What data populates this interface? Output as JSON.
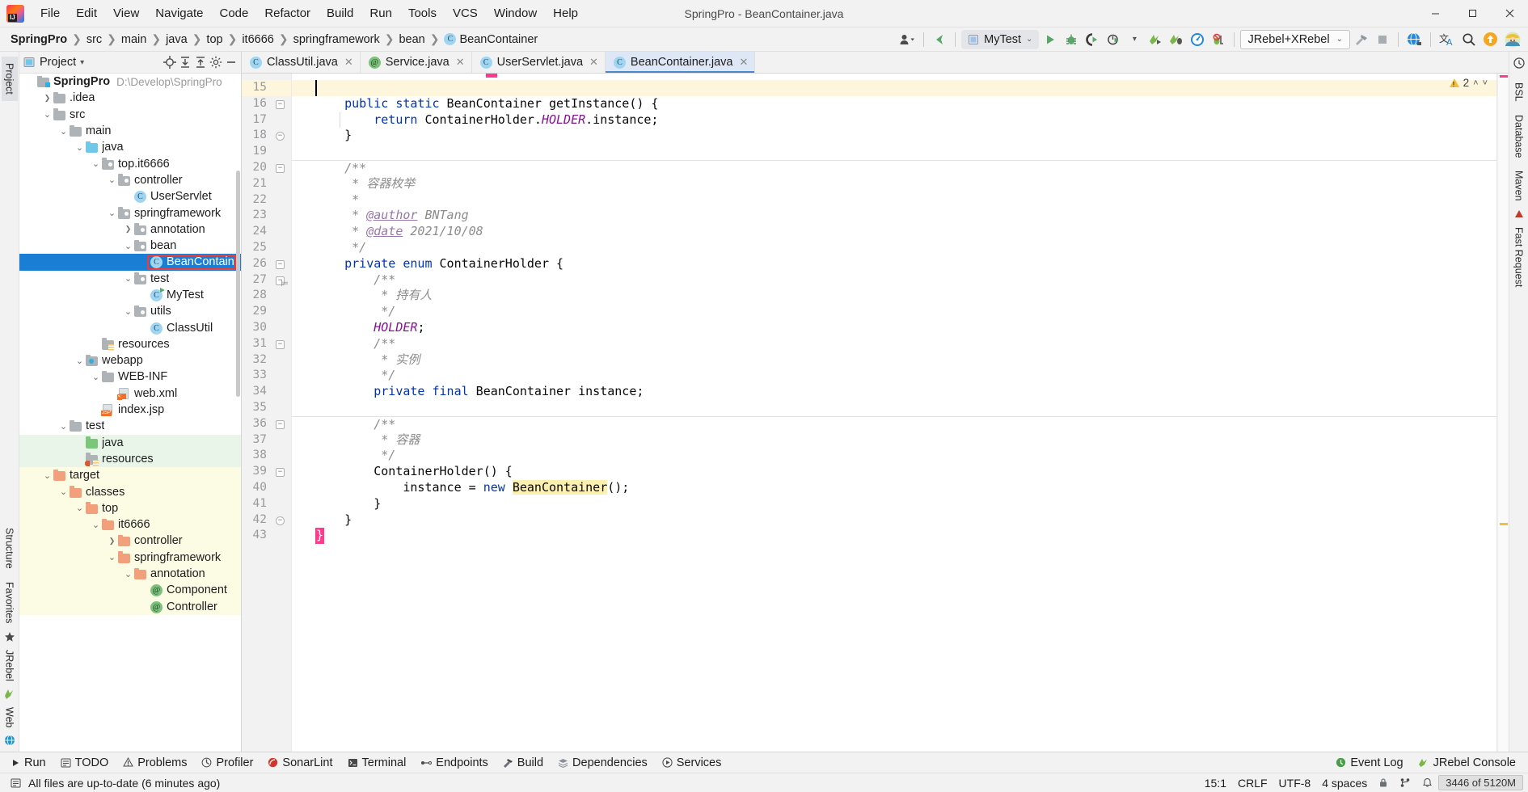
{
  "window": {
    "title": "SpringPro - BeanContainer.java",
    "controls": {
      "minimize": "—",
      "maximize": "▢",
      "close": "✕"
    }
  },
  "menu": [
    {
      "label": "File"
    },
    {
      "label": "Edit"
    },
    {
      "label": "View"
    },
    {
      "label": "Navigate"
    },
    {
      "label": "Code"
    },
    {
      "label": "Refactor"
    },
    {
      "label": "Build"
    },
    {
      "label": "Run"
    },
    {
      "label": "Tools"
    },
    {
      "label": "VCS"
    },
    {
      "label": "Window"
    },
    {
      "label": "Help"
    }
  ],
  "breadcrumbs": [
    {
      "label": "SpringPro",
      "bold": true
    },
    {
      "label": "src"
    },
    {
      "label": "main"
    },
    {
      "label": "java"
    },
    {
      "label": "top"
    },
    {
      "label": "it6666"
    },
    {
      "label": "springframework"
    },
    {
      "label": "bean"
    },
    {
      "label": "BeanContainer",
      "icon": "class-icon"
    }
  ],
  "toolbar": {
    "run_config": "MyTest",
    "jrebel_config": "JRebel+XRebel",
    "icons": [
      "user-settings-icon",
      "back-arrow-icon",
      "run-icon",
      "debug-icon",
      "run-coverage-icon",
      "profile-icon",
      "jrebel-run-icon",
      "jrebel-debug-icon",
      "xrebel-icon",
      "stop-debug-icon",
      "hammer-icon",
      "stop-icon",
      "jrebel-globe-icon",
      "translate-icon",
      "search-everywhere-icon",
      "update-icon",
      "avatar-icon"
    ]
  },
  "left_rail": {
    "top": [
      "Project"
    ],
    "middle": [
      "Structure",
      "Favorites"
    ],
    "bottom": [
      "JRebel",
      "Web"
    ]
  },
  "right_rail": {
    "items": [
      "BSL",
      "Database",
      "Maven",
      "Fast Request"
    ]
  },
  "project_panel": {
    "title": "Project",
    "actions": [
      "locate-icon",
      "expand-all-icon",
      "collapse-all-icon",
      "gear-icon",
      "hide-icon"
    ],
    "tree": [
      {
        "depth": 0,
        "label": "SpringPro",
        "path": "D:\\Develop\\SpringPro",
        "icon": "module-folder",
        "arrow": "",
        "bold": true
      },
      {
        "depth": 1,
        "label": ".idea",
        "icon": "folder-gray",
        "arrow": "right"
      },
      {
        "depth": 1,
        "label": "src",
        "icon": "folder-gray",
        "arrow": "down"
      },
      {
        "depth": 2,
        "label": "main",
        "icon": "folder-gray",
        "arrow": "down"
      },
      {
        "depth": 3,
        "label": "java",
        "icon": "folder-blue",
        "arrow": "down"
      },
      {
        "depth": 4,
        "label": "top.it6666",
        "icon": "package",
        "arrow": "down"
      },
      {
        "depth": 5,
        "label": "controller",
        "icon": "package",
        "arrow": "down"
      },
      {
        "depth": 6,
        "label": "UserServlet",
        "icon": "class"
      },
      {
        "depth": 5,
        "label": "springframework",
        "icon": "package",
        "arrow": "down"
      },
      {
        "depth": 6,
        "label": "annotation",
        "icon": "package",
        "arrow": "right"
      },
      {
        "depth": 6,
        "label": "bean",
        "icon": "package",
        "arrow": "down"
      },
      {
        "depth": 7,
        "label": "BeanContainer",
        "icon": "class",
        "selected": true,
        "outlined": true
      },
      {
        "depth": 6,
        "label": "test",
        "icon": "package",
        "arrow": "down"
      },
      {
        "depth": 7,
        "label": "MyTest",
        "icon": "class-runnable"
      },
      {
        "depth": 6,
        "label": "utils",
        "icon": "package",
        "arrow": "down"
      },
      {
        "depth": 7,
        "label": "ClassUtil",
        "icon": "class"
      },
      {
        "depth": 4,
        "label": "resources",
        "icon": "resource-folder"
      },
      {
        "depth": 3,
        "label": "webapp",
        "icon": "webapp-folder",
        "arrow": "down"
      },
      {
        "depth": 4,
        "label": "WEB-INF",
        "icon": "folder-gray",
        "arrow": "down"
      },
      {
        "depth": 5,
        "label": "web.xml",
        "icon": "xml-file"
      },
      {
        "depth": 4,
        "label": "index.jsp",
        "icon": "jsp-file"
      },
      {
        "depth": 2,
        "label": "test",
        "icon": "folder-gray",
        "arrow": "down"
      },
      {
        "depth": 3,
        "label": "java",
        "icon": "folder-green",
        "arrow": "",
        "bg": "green"
      },
      {
        "depth": 3,
        "label": "resources",
        "icon": "test-resource-folder",
        "bg": "green"
      },
      {
        "depth": 1,
        "label": "target",
        "icon": "folder-orange",
        "arrow": "down",
        "bg": "yellow"
      },
      {
        "depth": 2,
        "label": "classes",
        "icon": "folder-orange",
        "arrow": "down",
        "bg": "yellow"
      },
      {
        "depth": 3,
        "label": "top",
        "icon": "folder-orange",
        "arrow": "down",
        "bg": "yellow"
      },
      {
        "depth": 4,
        "label": "it6666",
        "icon": "folder-orange",
        "arrow": "down",
        "bg": "yellow"
      },
      {
        "depth": 5,
        "label": "controller",
        "icon": "folder-orange",
        "arrow": "right",
        "bg": "yellow"
      },
      {
        "depth": 5,
        "label": "springframework",
        "icon": "folder-orange",
        "arrow": "down",
        "bg": "yellow"
      },
      {
        "depth": 6,
        "label": "annotation",
        "icon": "folder-orange",
        "arrow": "down",
        "bg": "yellow"
      },
      {
        "depth": 7,
        "label": "Component",
        "icon": "annotation-class",
        "bg": "yellow"
      },
      {
        "depth": 7,
        "label": "Controller",
        "icon": "annotation-class",
        "bg": "yellow"
      }
    ]
  },
  "editor": {
    "tabs": [
      {
        "label": "ClassUtil.java",
        "icon": "class-icon",
        "active": false
      },
      {
        "label": "Service.java",
        "icon": "annotation-icon",
        "active": false
      },
      {
        "label": "UserServlet.java",
        "icon": "class-icon",
        "active": false
      },
      {
        "label": "BeanContainer.java",
        "icon": "class-icon",
        "active": true
      }
    ],
    "inspection": {
      "warnings": "2",
      "up": "˄",
      "down": "˅"
    },
    "first_line": 15,
    "lines": [
      {
        "n": 15,
        "highlight": true,
        "text": ""
      },
      {
        "n": 16,
        "fold": "minus",
        "tokens": [
          {
            "t": "    ",
            "c": ""
          },
          {
            "t": "public",
            "c": "kw"
          },
          {
            "t": " ",
            "c": ""
          },
          {
            "t": "static",
            "c": "kw"
          },
          {
            "t": " BeanContainer getInstance() {",
            "c": ""
          }
        ]
      },
      {
        "n": 17,
        "guide": true,
        "tokens": [
          {
            "t": "        ",
            "c": ""
          },
          {
            "t": "return",
            "c": "kw"
          },
          {
            "t": " ContainerHolder.",
            "c": ""
          },
          {
            "t": "HOLDER",
            "c": "stc"
          },
          {
            "t": ".instance;",
            "c": ""
          }
        ]
      },
      {
        "n": 18,
        "fold": "minus-round",
        "tokens": [
          {
            "t": "    }",
            "c": ""
          }
        ]
      },
      {
        "n": 19,
        "tokens": []
      },
      {
        "n": 20,
        "sep": true,
        "fold": "minus",
        "tokens": [
          {
            "t": "    /**",
            "c": "cm"
          }
        ]
      },
      {
        "n": 21,
        "tokens": [
          {
            "t": "     * 容器枚举",
            "c": "cm"
          }
        ]
      },
      {
        "n": 22,
        "tokens": [
          {
            "t": "     *",
            "c": "cm"
          }
        ]
      },
      {
        "n": 23,
        "tokens": [
          {
            "t": "     * ",
            "c": "cm"
          },
          {
            "t": "@author",
            "c": "cmtag"
          },
          {
            "t": " BNTang",
            "c": "cm"
          }
        ]
      },
      {
        "n": 24,
        "tokens": [
          {
            "t": "     * ",
            "c": "cm"
          },
          {
            "t": "@date",
            "c": "cmtag"
          },
          {
            "t": " 2021/10/08",
            "c": "cm"
          }
        ]
      },
      {
        "n": 25,
        "tokens": [
          {
            "t": "     */",
            "c": "cm"
          }
        ]
      },
      {
        "n": 26,
        "fold": "minus",
        "tokens": [
          {
            "t": "    ",
            "c": ""
          },
          {
            "t": "private",
            "c": "kw"
          },
          {
            "t": " ",
            "c": ""
          },
          {
            "t": "enum",
            "c": "kw"
          },
          {
            "t": " ContainerHolder {",
            "c": ""
          }
        ]
      },
      {
        "n": 27,
        "fold": "minus",
        "bookmark": true,
        "tokens": [
          {
            "t": "        /**",
            "c": "cm"
          }
        ]
      },
      {
        "n": 28,
        "tokens": [
          {
            "t": "         * 持有人",
            "c": "cm"
          }
        ]
      },
      {
        "n": 29,
        "tokens": [
          {
            "t": "         */",
            "c": "cm"
          }
        ]
      },
      {
        "n": 30,
        "tokens": [
          {
            "t": "        ",
            "c": ""
          },
          {
            "t": "HOLDER",
            "c": "stc"
          },
          {
            "t": ";",
            "c": ""
          }
        ]
      },
      {
        "n": 31,
        "fold": "minus",
        "tokens": [
          {
            "t": "        /**",
            "c": "cm"
          }
        ]
      },
      {
        "n": 32,
        "tokens": [
          {
            "t": "         * 实例",
            "c": "cm"
          }
        ]
      },
      {
        "n": 33,
        "tokens": [
          {
            "t": "         */",
            "c": "cm"
          }
        ]
      },
      {
        "n": 34,
        "tokens": [
          {
            "t": "        ",
            "c": ""
          },
          {
            "t": "private",
            "c": "kw"
          },
          {
            "t": " ",
            "c": ""
          },
          {
            "t": "final",
            "c": "kw"
          },
          {
            "t": " BeanContainer instance;",
            "c": ""
          }
        ]
      },
      {
        "n": 35,
        "tokens": []
      },
      {
        "n": 36,
        "sep": true,
        "fold": "minus",
        "tokens": [
          {
            "t": "        /**",
            "c": "cm"
          }
        ]
      },
      {
        "n": 37,
        "tokens": [
          {
            "t": "         * 容器",
            "c": "cm"
          }
        ]
      },
      {
        "n": 38,
        "tokens": [
          {
            "t": "         */",
            "c": "cm"
          }
        ]
      },
      {
        "n": 39,
        "fold": "minus",
        "tokens": [
          {
            "t": "        ContainerHolder() {",
            "c": ""
          }
        ]
      },
      {
        "n": 40,
        "tokens": [
          {
            "t": "            instance = ",
            "c": ""
          },
          {
            "t": "new",
            "c": "kw"
          },
          {
            "t": " ",
            "c": ""
          },
          {
            "t": "BeanContainer",
            "c": "hlmark"
          },
          {
            "t": "();",
            "c": ""
          }
        ]
      },
      {
        "n": 41,
        "tokens": [
          {
            "t": "        }",
            "c": ""
          }
        ]
      },
      {
        "n": 42,
        "fold": "minus-round",
        "tokens": [
          {
            "t": "    }",
            "c": ""
          }
        ]
      },
      {
        "n": 43,
        "error": true,
        "tokens": [
          {
            "t": "}",
            "c": "err"
          }
        ]
      }
    ]
  },
  "bottom_bar": {
    "items": [
      {
        "label": "Run",
        "icon": "run-icon"
      },
      {
        "label": "TODO",
        "icon": "todo-icon"
      },
      {
        "label": "Problems",
        "icon": "problems-icon"
      },
      {
        "label": "Profiler",
        "icon": "profiler-icon"
      },
      {
        "label": "SonarLint",
        "icon": "sonarlint-icon"
      },
      {
        "label": "Terminal",
        "icon": "terminal-icon"
      },
      {
        "label": "Endpoints",
        "icon": "endpoints-icon"
      },
      {
        "label": "Build",
        "icon": "build-icon"
      },
      {
        "label": "Dependencies",
        "icon": "dependencies-icon"
      },
      {
        "label": "Services",
        "icon": "services-icon"
      }
    ],
    "right": [
      {
        "label": "Event Log",
        "icon": "event-log-icon"
      },
      {
        "label": "JRebel Console",
        "icon": "jrebel-icon"
      }
    ]
  },
  "status_bar": {
    "message": "All files are up-to-date (6 minutes ago)",
    "caret": "15:1",
    "line_sep": "CRLF",
    "encoding": "UTF-8",
    "indent": "4 spaces",
    "memory": "3446 of 5120M",
    "icons": [
      "lock-icon",
      "branch-icon",
      "notification-icon"
    ]
  }
}
